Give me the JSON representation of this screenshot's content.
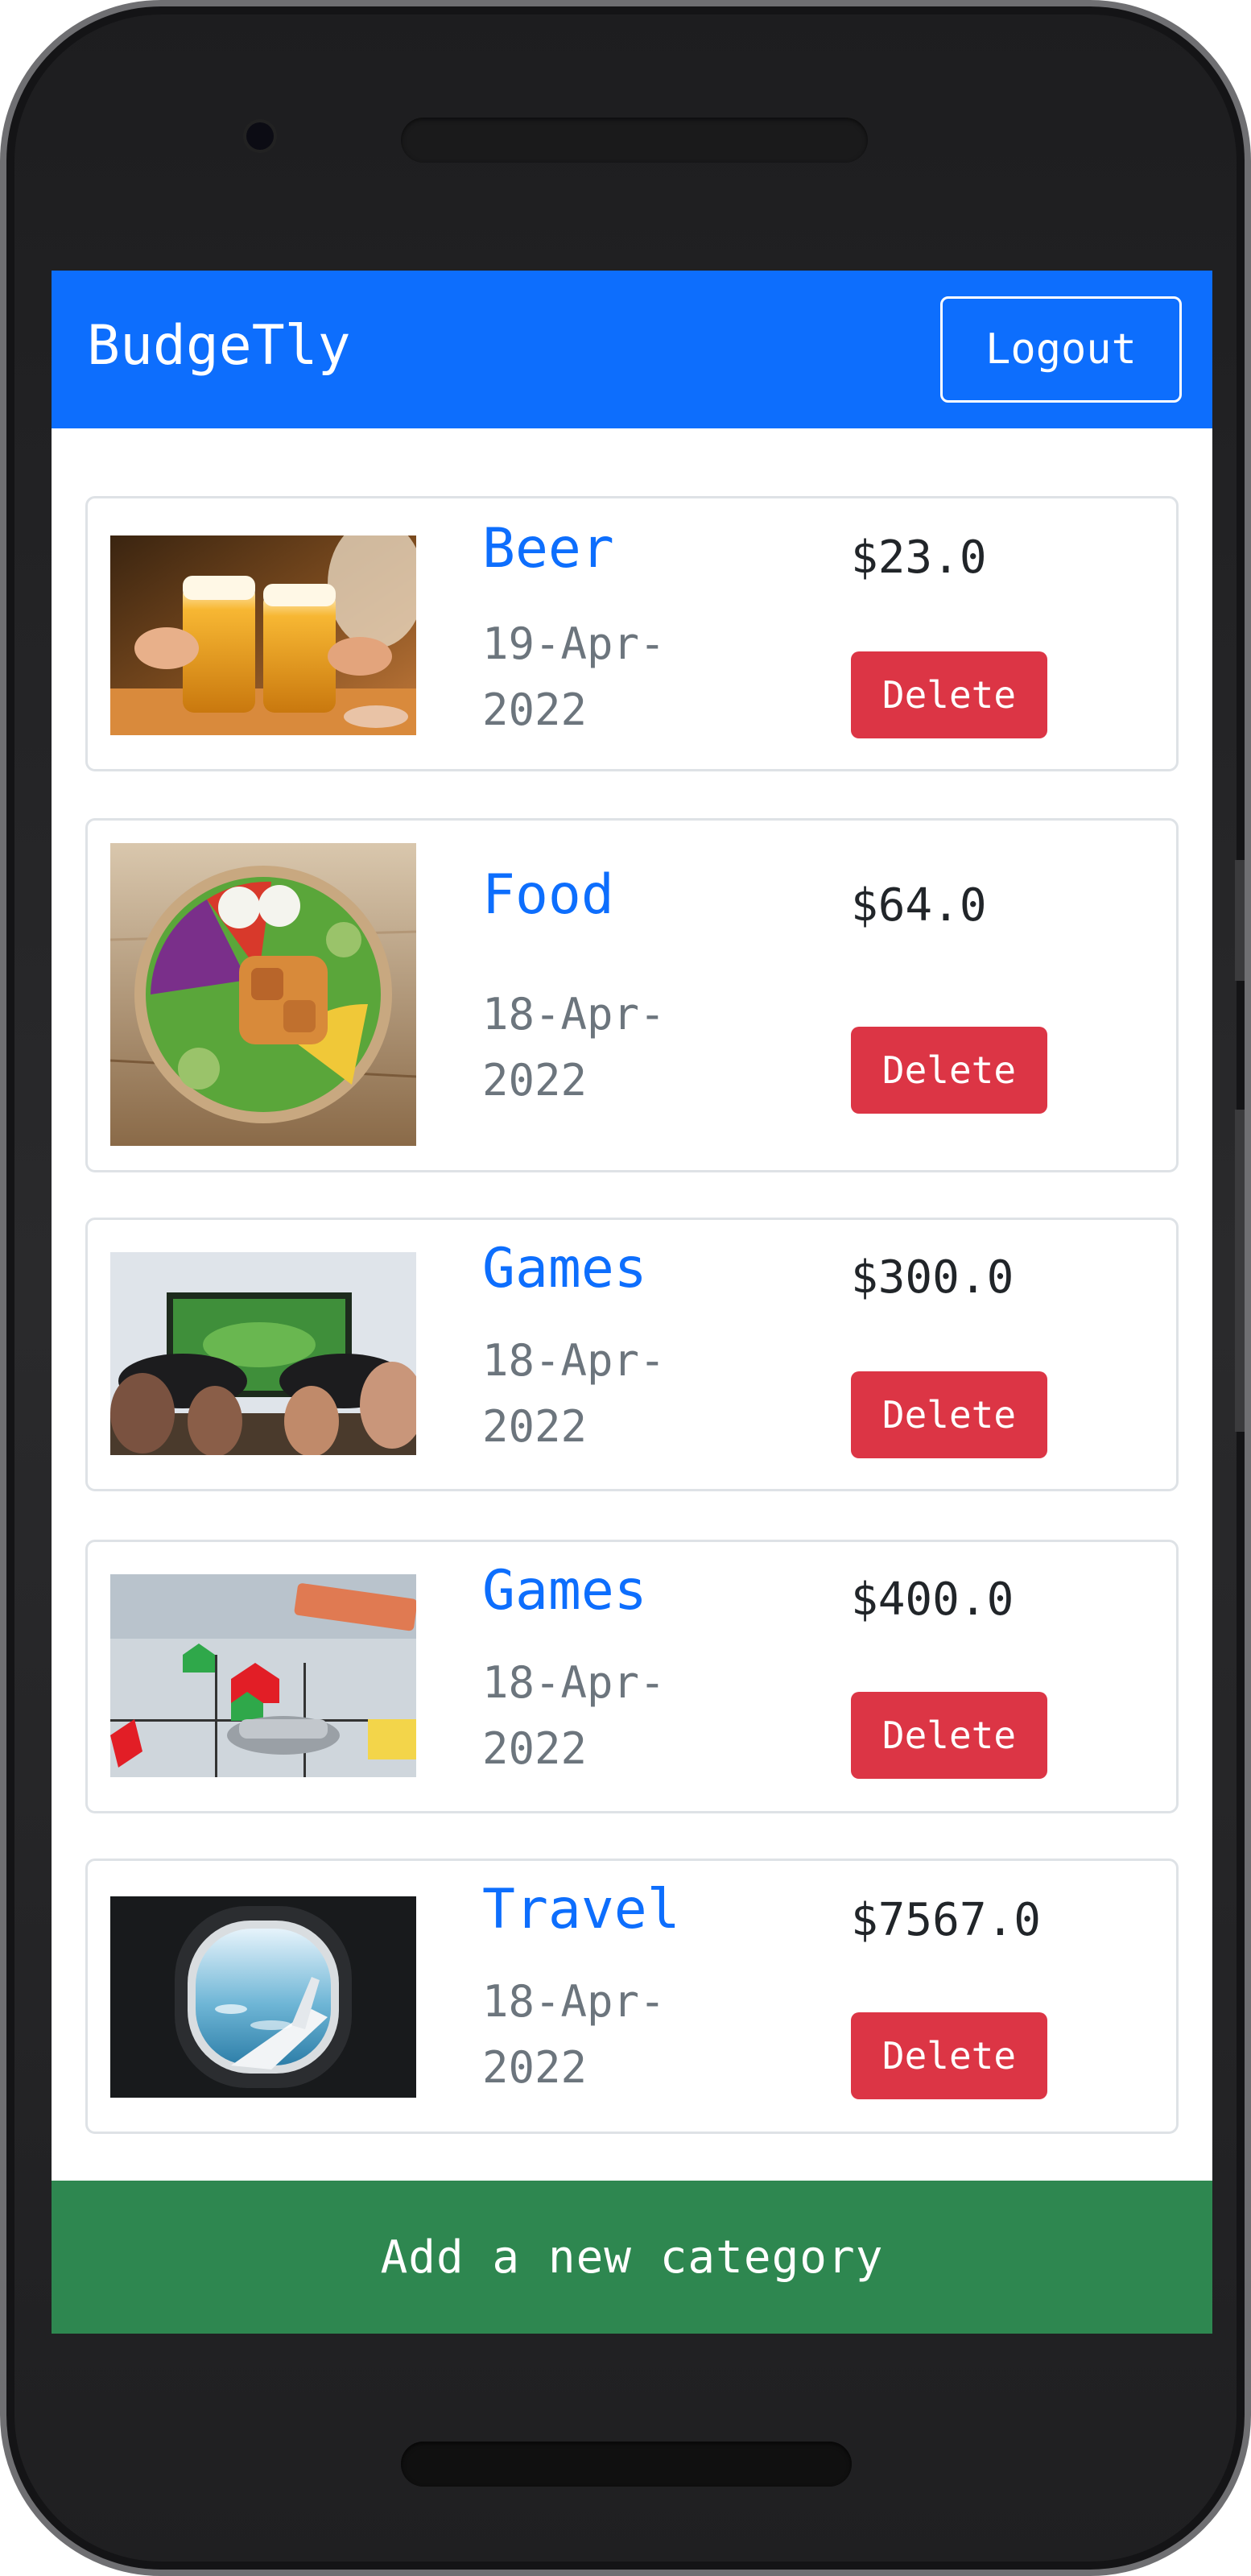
{
  "app": {
    "brand": "BudgeTly",
    "logout_label": "Logout",
    "accent_color": "#0d6efd",
    "danger_color": "#dc3545",
    "success_color": "#2e8750"
  },
  "categories": [
    {
      "title": "Beer",
      "date": "19-Apr-2022",
      "amount": "$23.0",
      "delete_label": "Delete",
      "image_icon": "beer-mugs-photo"
    },
    {
      "title": "Food",
      "date": "18-Apr-2022",
      "amount": "$64.0",
      "delete_label": "Delete",
      "image_icon": "salad-bowl-photo"
    },
    {
      "title": "Games",
      "date": "18-Apr-2022",
      "amount": "$300.0",
      "delete_label": "Delete",
      "image_icon": "game-controllers-photo"
    },
    {
      "title": "Games",
      "date": "18-Apr-2022",
      "amount": "$400.0",
      "delete_label": "Delete",
      "image_icon": "board-game-photo"
    },
    {
      "title": "Travel",
      "date": "18-Apr-2022",
      "amount": "$7567.0",
      "delete_label": "Delete",
      "image_icon": "airplane-window-photo"
    }
  ],
  "footer": {
    "add_label": "Add a new category"
  }
}
